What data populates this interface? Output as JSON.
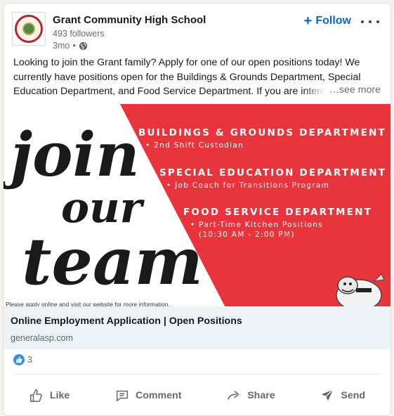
{
  "post": {
    "org_name": "Grant Community High School",
    "followers": "493 followers",
    "time": "3mo",
    "time_sep": "•",
    "follow_label": "Follow",
    "follow_plus": "+",
    "text": "Looking to join the Grant family? Apply for one of our open positions today! We currently have positions open for the Buildings & Grounds Department, Special Education Department, and Food Service Department. If you are interested",
    "see_more": "…see more"
  },
  "image": {
    "script_line1": "join",
    "script_line2": "our",
    "script_line3": "team",
    "departments": [
      {
        "title": "BUILDINGS & GROUNDS DEPARTMENT",
        "sub": "• 2nd Shift Custodian",
        "sub2": ""
      },
      {
        "title": "SPECIAL EDUCATION DEPARTMENT",
        "sub": "• Job Coach for Transitions Program",
        "sub2": ""
      },
      {
        "title": "FOOD SERVICE DEPARTMENT",
        "sub": "• Part-Time Kitchen Positions",
        "sub2": "(10:30 AM - 2:00 PM)"
      }
    ],
    "footer_note": "Please apply online and visit our website for more information.",
    "accent_color": "#e8343a"
  },
  "link": {
    "title": "Online Employment Application | Open Positions",
    "domain": "generalasp.com"
  },
  "reactions": {
    "count": "3",
    "icon": "like-reaction-icon"
  },
  "actions": {
    "like": "Like",
    "comment": "Comment",
    "share": "Share",
    "send": "Send"
  },
  "colors": {
    "brand_blue": "#0a66c2",
    "link_bar_bg": "#eef3f8"
  }
}
